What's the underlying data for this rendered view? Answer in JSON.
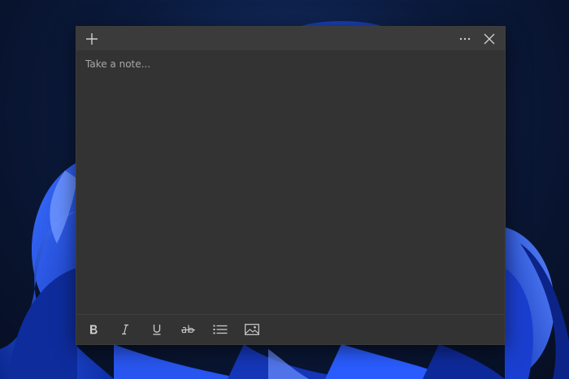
{
  "note": {
    "placeholder": "Take a note...",
    "value": ""
  },
  "titlebar": {
    "icons": {
      "new_note": "plus-icon",
      "menu": "more-icon",
      "close": "close-icon"
    }
  },
  "format_toolbar": {
    "icons": [
      "bold-icon",
      "italic-icon",
      "underline-icon",
      "strikethrough-icon",
      "bullet-list-icon",
      "image-icon"
    ]
  },
  "colors": {
    "window_bg": "#333333",
    "titlebar_bg": "#3b3b3b",
    "icon": "#cfcfcf",
    "placeholder": "#a8a8a8",
    "wallpaper_accent": "#1f4fe0"
  }
}
